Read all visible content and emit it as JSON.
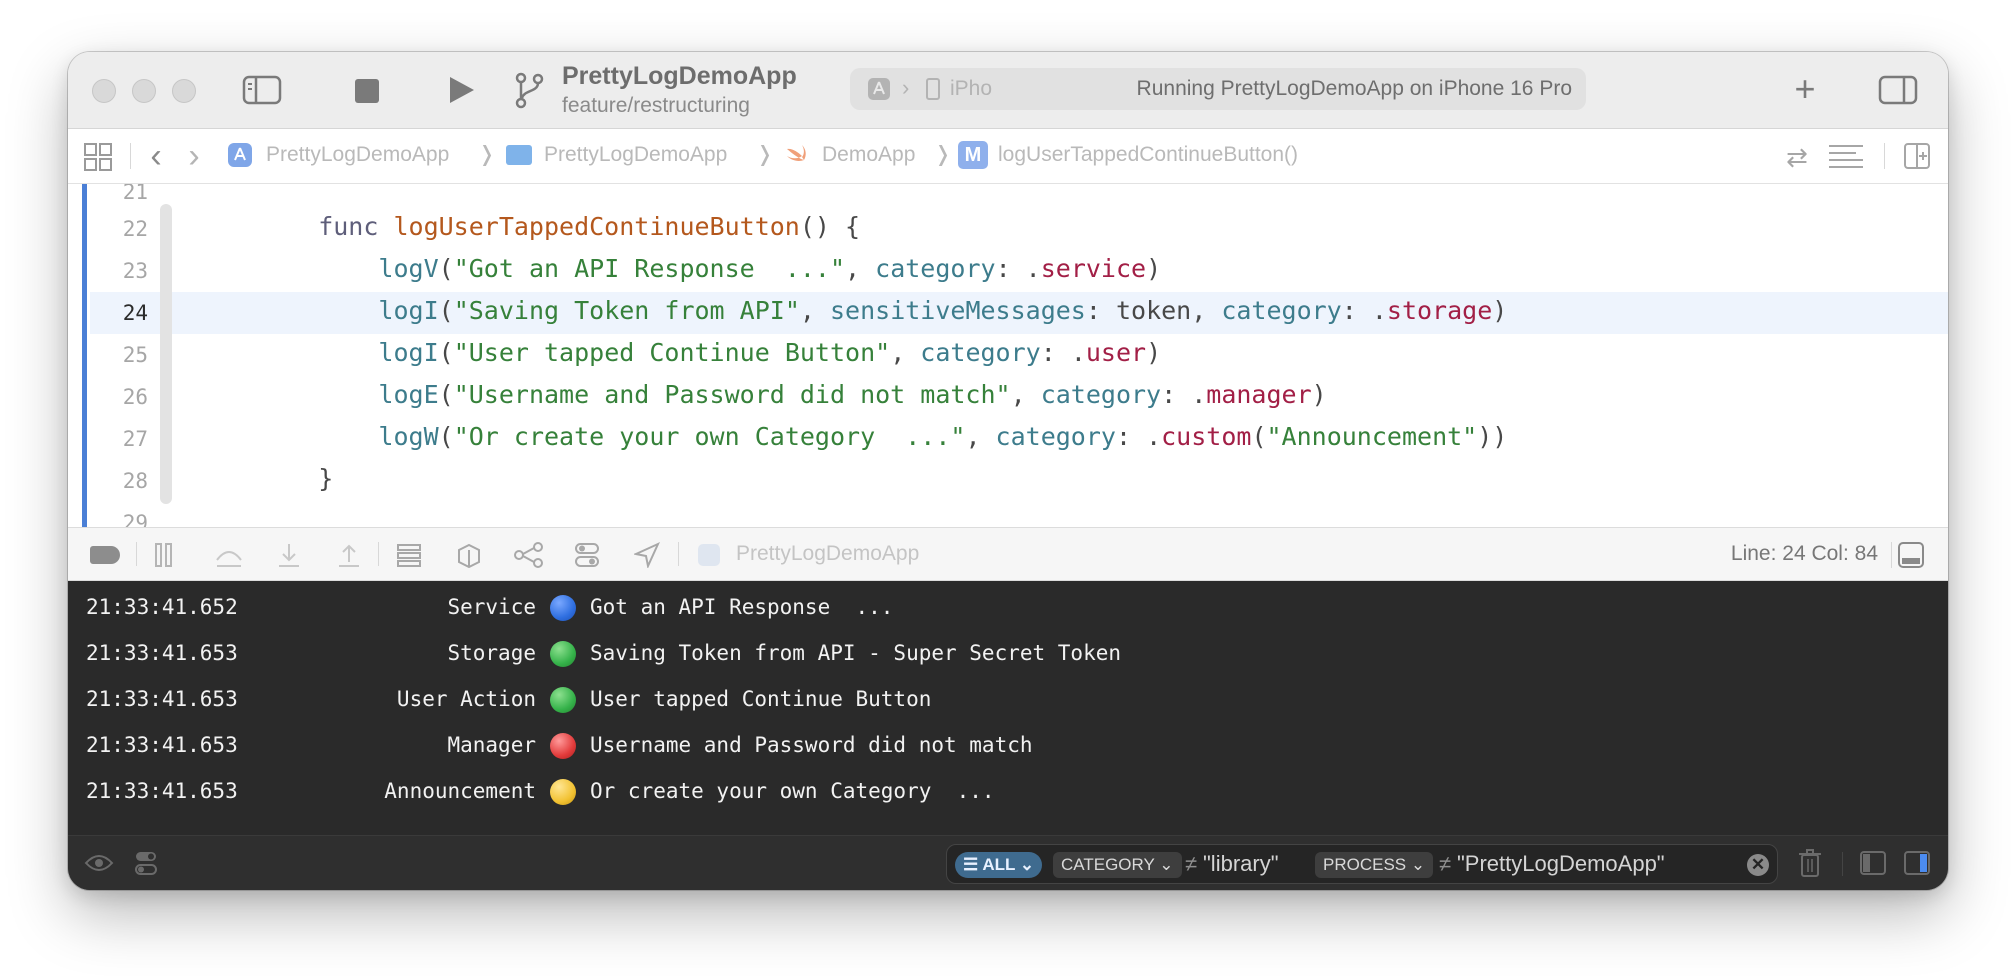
{
  "toolbar": {
    "scheme_name": "PrettyLogDemoApp",
    "branch": "feature/restructuring",
    "activity_destination": "iPho",
    "activity_status": "Running PrettyLogDemoApp on iPhone 16 Pro"
  },
  "jumpbar": {
    "crumbs": [
      "PrettyLogDemoApp",
      "PrettyLogDemoApp",
      "DemoApp",
      "logUserTappedContinueButton()"
    ],
    "method_badge": "M"
  },
  "editor": {
    "line_numbers": [
      "21",
      "22",
      "23",
      "24",
      "25",
      "26",
      "27",
      "28",
      "29"
    ],
    "current_line": "24"
  },
  "debugbar": {
    "target": "PrettyLogDemoApp",
    "position": "Line: 24  Col: 84"
  },
  "console": {
    "rows": [
      {
        "time": "21:33:41.652",
        "category": "Service",
        "color": "#2f6fe0",
        "message": "Got an API Response  ..."
      },
      {
        "time": "21:33:41.653",
        "category": "Storage",
        "color": "#35b24a",
        "message": "Saving Token from API - Super Secret Token"
      },
      {
        "time": "21:33:41.653",
        "category": "User Action",
        "color": "#35b24a",
        "message": "User tapped Continue Button"
      },
      {
        "time": "21:33:41.653",
        "category": "Manager",
        "color": "#e23b3b",
        "message": "Username and Password did not match"
      },
      {
        "time": "21:33:41.653",
        "category": "Announcement",
        "color": "#f2c232",
        "message": "Or create your own Category  ..."
      }
    ],
    "filter": {
      "all_label": "ALL",
      "category_label": "CATEGORY",
      "category_op": "≠",
      "category_value": "\"library\"",
      "process_label": "PROCESS",
      "process_op": "≠",
      "process_value": "\"PrettyLogDemoApp\""
    }
  }
}
